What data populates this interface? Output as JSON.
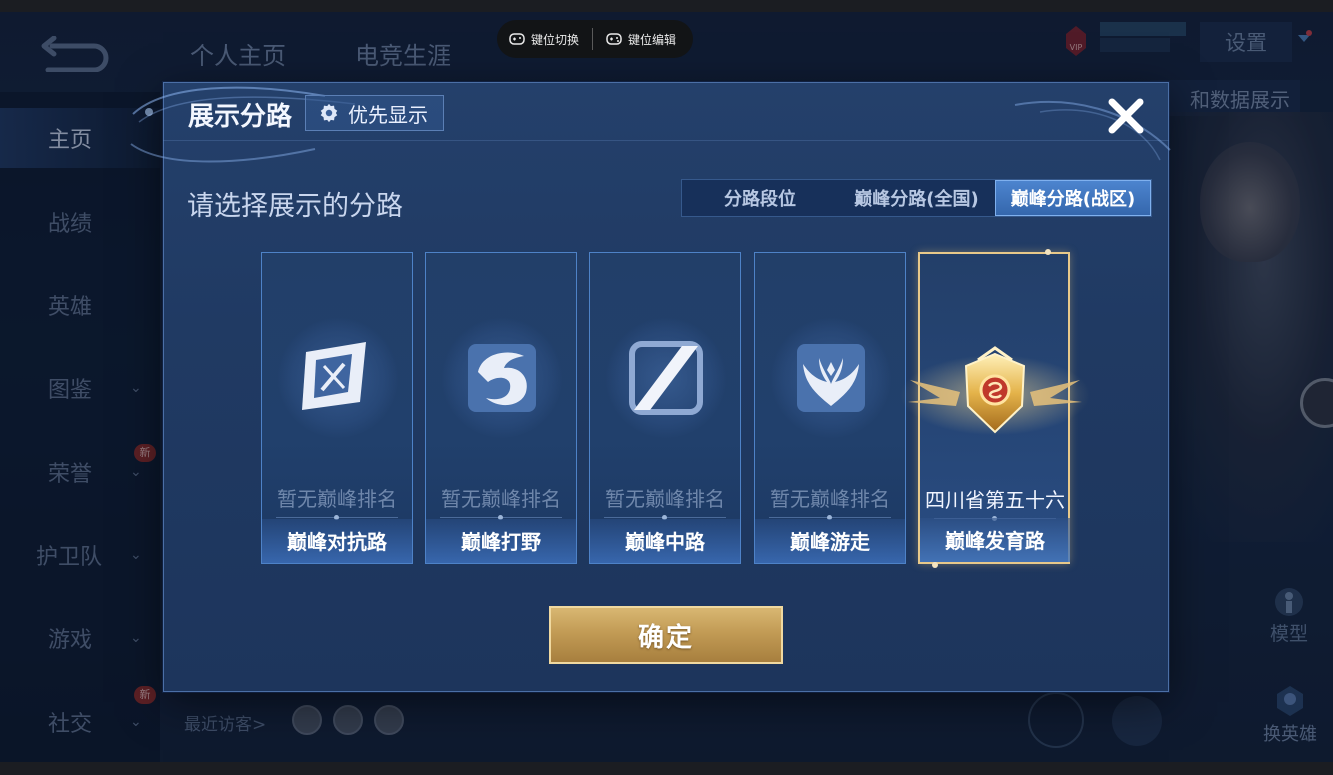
{
  "background": {
    "top_tabs": [
      "个人主页",
      "电竞生涯"
    ],
    "sidebar": [
      {
        "label": "主页",
        "active": true,
        "chevron": false,
        "new": false
      },
      {
        "label": "战绩",
        "active": false,
        "chevron": false,
        "new": false
      },
      {
        "label": "英雄",
        "active": false,
        "chevron": false,
        "new": false
      },
      {
        "label": "图鉴",
        "active": false,
        "chevron": true,
        "new": false
      },
      {
        "label": "荣誉",
        "active": false,
        "chevron": true,
        "new": true
      },
      {
        "label": "护卫队",
        "active": false,
        "chevron": true,
        "new": false
      },
      {
        "label": "游戏",
        "active": false,
        "chevron": true,
        "new": false
      },
      {
        "label": "社交",
        "active": false,
        "chevron": true,
        "new": true
      }
    ],
    "new_badge": "新",
    "vip_label": "VIP",
    "settings_label": "设置",
    "data_show_label": "和数据展示",
    "model_label": "模型",
    "switch_hero_label": "换英雄",
    "recent_visitors_label": "最近访客>"
  },
  "keymap_bar": {
    "switch_label": "键位切换",
    "edit_label": "键位编辑"
  },
  "modal": {
    "title": "展示分路",
    "priority_label": "优先显示",
    "subtitle": "请选择展示的分路",
    "segments": [
      "分路段位",
      "巅峰分路(全国)",
      "巅峰分路(战区)"
    ],
    "selected_segment": "巅峰分路(战区)",
    "cards": [
      {
        "rank": "暂无巅峰排名",
        "lane": "巅峰对抗路",
        "icon": "clash-lane-icon"
      },
      {
        "rank": "暂无巅峰排名",
        "lane": "巅峰打野",
        "icon": "jungle-dragon-icon"
      },
      {
        "rank": "暂无巅峰排名",
        "lane": "巅峰中路",
        "icon": "mid-lane-icon"
      },
      {
        "rank": "暂无巅峰排名",
        "lane": "巅峰游走",
        "icon": "roam-wings-icon"
      },
      {
        "rank": "四川省第五十六",
        "lane": "巅峰发育路",
        "icon": "gold-badge-icon",
        "selected": true
      }
    ],
    "confirm_label": "确定"
  },
  "colors": {
    "modal_bg": "#21406c",
    "accent_blue": "#3f75c0",
    "gold": "#c8a25c",
    "selected_border": "#e8c98a"
  }
}
